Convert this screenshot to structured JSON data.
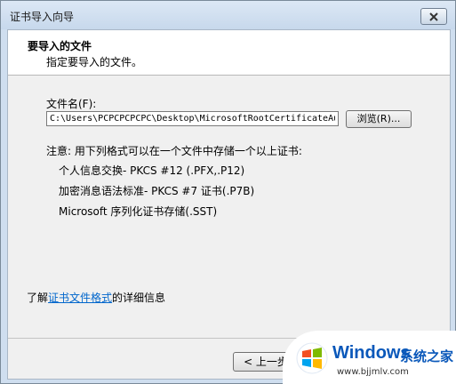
{
  "window": {
    "title": "证书导入向导"
  },
  "header": {
    "title": "要导入的文件",
    "subtitle": "指定要导入的文件。"
  },
  "file": {
    "label": "文件名(F):",
    "value": "C:\\Users\\PCPCPCPCPC\\Desktop\\MicrosoftRootCertificateAu",
    "browse_label": "浏览(R)..."
  },
  "note": {
    "text": "注意: 用下列格式可以在一个文件中存储一个以上证书:",
    "formats": [
      "个人信息交换- PKCS #12 (.PFX,.P12)",
      "加密消息语法标准- PKCS #7 证书(.P7B)",
      "Microsoft 序列化证书存储(.SST)"
    ]
  },
  "learn_more": {
    "prefix": "了解",
    "link": "证书文件格式",
    "suffix": "的详细信息"
  },
  "buttons": {
    "back": "< 上一步"
  },
  "watermark": {
    "brand": "Windows",
    "cn": "系统之家",
    "url": "www.bjjmlv.com"
  },
  "colors": {
    "title_bar": "#cfdeef",
    "link": "#0066cc",
    "watermark_text": "#0a58ba"
  }
}
